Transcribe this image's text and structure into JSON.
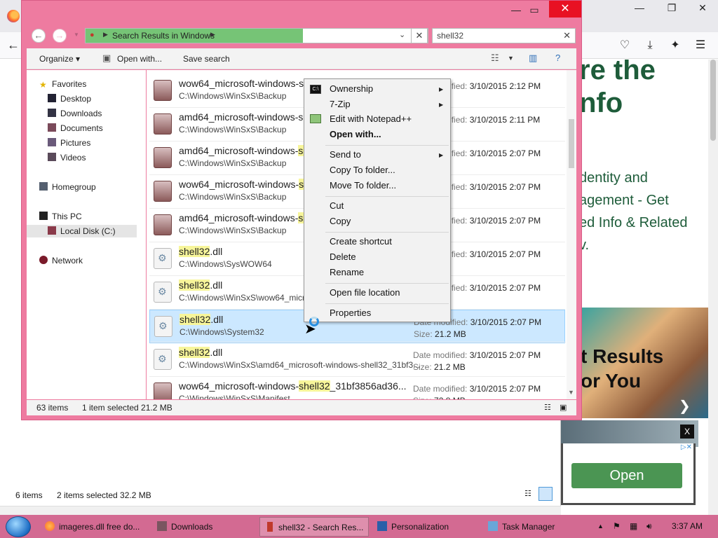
{
  "browser": {
    "web_heading_1": "re the",
    "web_heading_2": "nfo",
    "web_p1": "dentity and",
    "web_p2": "agement - Get",
    "web_p3": "ed Info & Related",
    "web_p4": "v.",
    "ad_text_1": "t Results",
    "ad_text_2": "or You",
    "ad2_close": "X",
    "ad3_button": "Open"
  },
  "bg_explorer": {
    "items_count": "6 items",
    "selected": "2 items selected  32.2 MB"
  },
  "explorer": {
    "address": "Search Results in Windows",
    "search_value": "shell32",
    "toolbar": {
      "organize": "Organize",
      "open_with": "Open with...",
      "save_search": "Save search"
    },
    "nav": {
      "favorites": "Favorites",
      "desktop": "Desktop",
      "downloads": "Downloads",
      "documents": "Documents",
      "pictures": "Pictures",
      "videos": "Videos",
      "homegroup": "Homegroup",
      "this_pc": "This PC",
      "local_disk": "Local Disk (C:)",
      "network": "Network"
    },
    "date_modified_label": "Date modified:",
    "size_label": "Size:",
    "rows": [
      {
        "name_pre": "wow64_microsoft-windows-s",
        "name_hl": "",
        "name_post": "",
        "path": "C:\\Windows\\WinSxS\\Backup",
        "date": "3/10/2015 2:12 PM",
        "size": "MB"
      },
      {
        "name_pre": "amd64_microsoft-windows-sh",
        "name_hl": "",
        "name_post": "",
        "path": "C:\\Windows\\WinSxS\\Backup",
        "date": "3/10/2015 2:11 PM",
        "size": "MB"
      },
      {
        "name_pre": "amd64_microsoft-windows-",
        "name_hl": "sl",
        "name_post": "",
        "path": "C:\\Windows\\WinSxS\\Backup",
        "date": "3/10/2015 2:07 PM",
        "size": "ytes"
      },
      {
        "name_pre": "wow64_microsoft-windows-",
        "name_hl": "s",
        "name_post": "",
        "path": "C:\\Windows\\WinSxS\\Backup",
        "date": "3/10/2015 2:07 PM",
        "size": "KB"
      },
      {
        "name_pre": "amd64_microsoft-windows-",
        "name_hl": "sl",
        "name_post": "",
        "path": "C:\\Windows\\WinSxS\\Backup",
        "date": "3/10/2015 2:07 PM",
        "size": "KB"
      },
      {
        "name_pre": "",
        "name_hl": "shell32",
        "name_post": ".dll",
        "path": "C:\\Windows\\SysWOW64",
        "date": "3/10/2015 2:07 PM",
        "size": "MB"
      },
      {
        "name_pre": "",
        "name_hl": "shell32",
        "name_post": ".dll",
        "path": "C:\\Windows\\WinSxS\\wow64_microso",
        "date": "3/10/2015 2:07 PM",
        "size": "MB"
      },
      {
        "name_pre": "",
        "name_hl": "shell32",
        "name_post": ".dll",
        "path": "C:\\Windows\\System32",
        "date": "3/10/2015 2:07 PM",
        "size": "21.2 MB"
      },
      {
        "name_pre": "",
        "name_hl": "shell32",
        "name_post": ".dll",
        "path": "C:\\Windows\\WinSxS\\amd64_microsoft-windows-shell32_31bf3...",
        "date": "3/10/2015 2:07 PM",
        "size": "21.2 MB"
      },
      {
        "name_pre": "wow64_microsoft-windows-",
        "name_hl": "shell32",
        "name_post": "_31bf3856ad36...",
        "path": "C:\\Windows\\WinSxS\\Manifest",
        "date": "3/10/2015 2:07 PM",
        "size": "72.8 MB"
      }
    ],
    "status": {
      "count": "63 items",
      "selected": "1 item selected  21.2 MB"
    }
  },
  "context_menu": {
    "ownership": "Ownership",
    "zip": "7-Zip",
    "notepad": "Edit with Notepad++",
    "open_with": "Open with...",
    "send_to": "Send to",
    "copy_to": "Copy To folder...",
    "move_to": "Move To folder...",
    "cut": "Cut",
    "copy": "Copy",
    "create_shortcut": "Create shortcut",
    "delete": "Delete",
    "rename": "Rename",
    "open_location": "Open file location",
    "properties": "Properties"
  },
  "taskbar": {
    "items": [
      "imageres.dll free do...",
      "Downloads",
      "shell32 - Search Res...",
      "Personalization",
      "Task Manager"
    ],
    "clock": "3:37 AM"
  },
  "colors": {
    "explorer_frame": "#ee7ba0",
    "taskbar": "#d36a92",
    "selection": "#cce8ff",
    "highlight": "#f7f59a",
    "close_red": "#e81123"
  }
}
